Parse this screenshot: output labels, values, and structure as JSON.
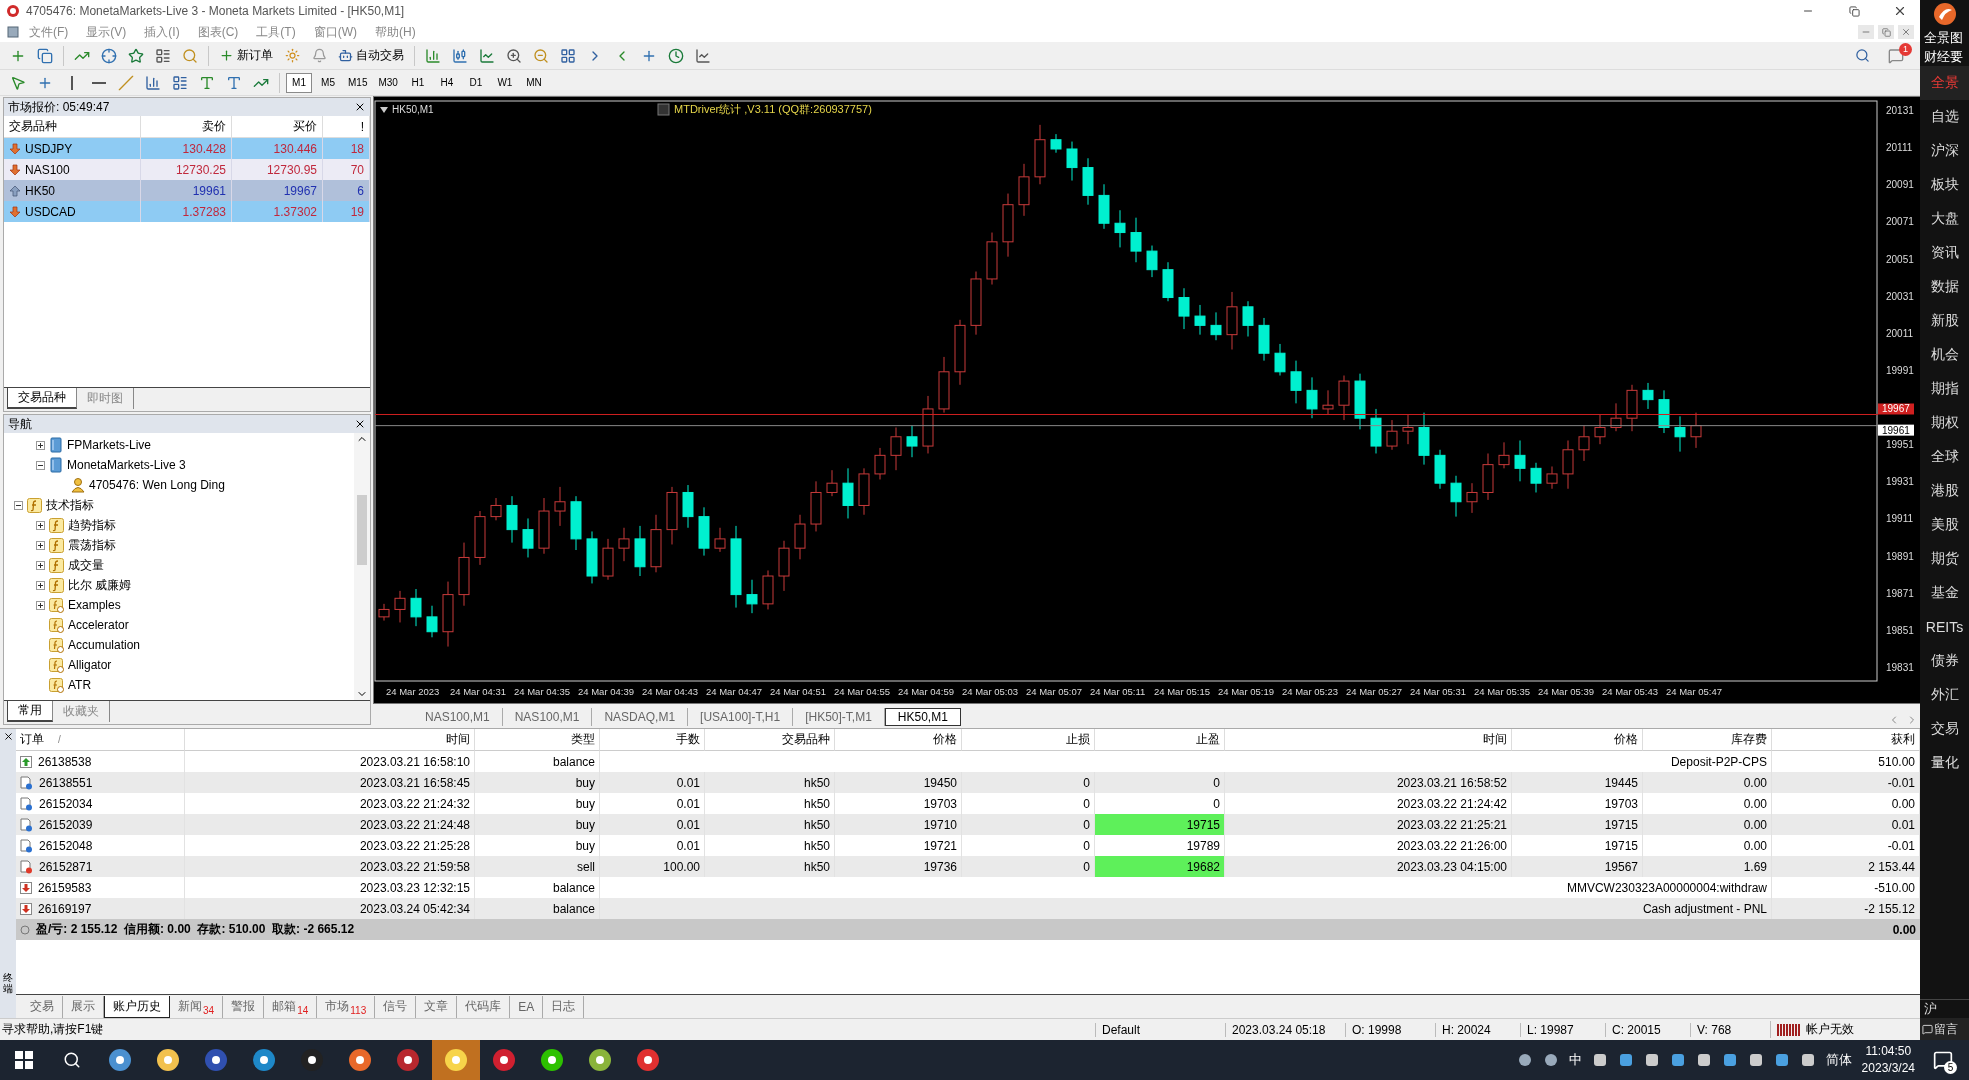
{
  "window": {
    "title": "4705476: MonetaMarkets-Live 3 - Moneta Markets Limited - [HK50,M1]"
  },
  "menu": [
    "文件(F)",
    "显示(V)",
    "插入(I)",
    "图表(C)",
    "工具(T)",
    "窗口(W)",
    "帮助(H)"
  ],
  "toolbar": {
    "new_order": "新订单",
    "auto_trading": "自动交易",
    "alert_count": "1"
  },
  "timeframes": [
    {
      "label": "M1",
      "selected": true
    },
    {
      "label": "M5",
      "selected": false
    },
    {
      "label": "M15",
      "selected": false
    },
    {
      "label": "M30",
      "selected": false
    },
    {
      "label": "H1",
      "selected": false
    },
    {
      "label": "H4",
      "selected": false
    },
    {
      "label": "D1",
      "selected": false
    },
    {
      "label": "W1",
      "selected": false
    },
    {
      "label": "MN",
      "selected": false
    }
  ],
  "market_watch": {
    "title": "市场报价: 05:49:47",
    "columns": [
      "交易品种",
      "卖价",
      "买价",
      "!"
    ],
    "rows": [
      {
        "symbol": "USDJPY",
        "bid": "130.428",
        "ask": "130.446",
        "spread": "18",
        "rising": false,
        "selected": true
      },
      {
        "symbol": "NAS100",
        "bid": "12730.25",
        "ask": "12730.95",
        "spread": "70",
        "rising": false,
        "selected": false
      },
      {
        "symbol": "HK50",
        "bid": "19961",
        "ask": "19967",
        "spread": "6",
        "rising": true,
        "selected": true
      },
      {
        "symbol": "USDCAD",
        "bid": "1.37283",
        "ask": "1.37302",
        "spread": "19",
        "rising": false,
        "selected": true
      }
    ],
    "tabs": [
      {
        "label": "交易品种",
        "selected": true
      },
      {
        "label": "即时图",
        "selected": false
      }
    ]
  },
  "navigator": {
    "title": "导航",
    "tree": [
      {
        "children": [
          {
            "label": "FPMarkets-Live",
            "kind": "server",
            "expanded": false
          },
          {
            "label": "MonetaMarkets-Live 3",
            "kind": "server",
            "expanded": true,
            "children": [
              {
                "label": "4705476: Wen Long Ding",
                "kind": "account"
              }
            ]
          }
        ]
      },
      {
        "label": "技术指标",
        "kind": "folder",
        "expanded": true,
        "children": [
          {
            "label": "趋势指标",
            "kind": "folder",
            "expanded": false
          },
          {
            "label": "震荡指标",
            "kind": "folder",
            "expanded": false
          },
          {
            "label": "成交量",
            "kind": "folder",
            "expanded": false
          },
          {
            "label": "比尔 威廉姆",
            "kind": "folder",
            "expanded": false
          },
          {
            "label": "Examples",
            "kind": "indicator",
            "expanded": false
          },
          {
            "label": "Accelerator",
            "kind": "indicator"
          },
          {
            "label": "Accumulation",
            "kind": "indicator"
          },
          {
            "label": "Alligator",
            "kind": "indicator"
          },
          {
            "label": "ATR",
            "kind": "indicator"
          }
        ]
      }
    ],
    "tabs": [
      {
        "label": "常用",
        "selected": true
      },
      {
        "label": "收藏夹",
        "selected": false
      }
    ]
  },
  "chart": {
    "symbol": "HK50,M1",
    "indicator": "MTDriver统计 ,V3.11 (QQ群:260937757)",
    "price_ticks": [
      "20131",
      "20111",
      "20091",
      "20071",
      "20051",
      "20031",
      "20011",
      "19991",
      "19951",
      "19931",
      "19911",
      "19891",
      "19871",
      "19851",
      "19831"
    ],
    "ask_label": "19967",
    "bid_label": "19961",
    "time_ticks": [
      "24 Mar 2023",
      "24 Mar 04:31",
      "24 Mar 04:35",
      "24 Mar 04:39",
      "24 Mar 04:43",
      "24 Mar 04:47",
      "24 Mar 04:51",
      "24 Mar 04:55",
      "24 Mar 04:59",
      "24 Mar 05:03",
      "24 Mar 05:07",
      "24 Mar 05:11",
      "24 Mar 05:15",
      "24 Mar 05:19",
      "24 Mar 05:23",
      "24 Mar 05:27",
      "24 Mar 05:31",
      "24 Mar 05:35",
      "24 Mar 05:39",
      "24 Mar 05:43",
      "24 Mar 05:47"
    ]
  },
  "chart_tabs": [
    {
      "label": "NAS100,M1",
      "selected": false
    },
    {
      "label": "NAS100,M1",
      "selected": false
    },
    {
      "label": "NASDAQ,M1",
      "selected": false
    },
    {
      "label": "[USA100]-T,H1",
      "selected": false
    },
    {
      "label": "[HK50]-T,M1",
      "selected": false
    },
    {
      "label": "HK50,M1",
      "selected": true
    }
  ],
  "terminal": {
    "side_label": "终端",
    "sort_mark": "/",
    "columns": [
      "订单",
      "时间",
      "类型",
      "手数",
      "交易品种",
      "价格",
      "止损",
      "止盈",
      "时间",
      "价格",
      "库存费",
      "获利"
    ],
    "rows": [
      {
        "kind": "deposit",
        "order": "26138538",
        "open_time": "2023.03.21 16:58:10",
        "type": "balance",
        "comment": "Deposit-P2P-CPS",
        "profit": "510.00"
      },
      {
        "kind": "buy",
        "order": "26138551",
        "open_time": "2023.03.21 16:58:45",
        "type": "buy",
        "size": "0.01",
        "symbol": "hk50",
        "open_price": "19450",
        "sl": "0",
        "tp": {
          "text": "0",
          "hit": false
        },
        "close_time": "2023.03.21 16:58:52",
        "close_price": "19445",
        "swap": "0.00",
        "profit": "-0.01"
      },
      {
        "kind": "buy",
        "order": "26152034",
        "open_time": "2023.03.22 21:24:32",
        "type": "buy",
        "size": "0.01",
        "symbol": "hk50",
        "open_price": "19703",
        "sl": "0",
        "tp": {
          "text": "0",
          "hit": false
        },
        "close_time": "2023.03.22 21:24:42",
        "close_price": "19703",
        "swap": "0.00",
        "profit": "0.00"
      },
      {
        "kind": "buy",
        "order": "26152039",
        "open_time": "2023.03.22 21:24:48",
        "type": "buy",
        "size": "0.01",
        "symbol": "hk50",
        "open_price": "19710",
        "sl": "0",
        "tp": {
          "text": "19715",
          "hit": true
        },
        "close_time": "2023.03.22 21:25:21",
        "close_price": "19715",
        "swap": "0.00",
        "profit": "0.01"
      },
      {
        "kind": "buy",
        "order": "26152048",
        "open_time": "2023.03.22 21:25:28",
        "type": "buy",
        "size": "0.01",
        "symbol": "hk50",
        "open_price": "19721",
        "sl": "0",
        "tp": {
          "text": "19789",
          "hit": false
        },
        "close_time": "2023.03.22 21:26:00",
        "close_price": "19715",
        "swap": "0.00",
        "profit": "-0.01"
      },
      {
        "kind": "sell",
        "order": "26152871",
        "open_time": "2023.03.22 21:59:58",
        "type": "sell",
        "size": "100.00",
        "symbol": "hk50",
        "open_price": "19736",
        "sl": "0",
        "tp": {
          "text": "19682",
          "hit": true
        },
        "close_time": "2023.03.23 04:15:00",
        "close_price": "19567",
        "swap": "1.69",
        "profit": "2 153.44"
      },
      {
        "kind": "withdrawal",
        "order": "26159583",
        "open_time": "2023.03.23 12:32:15",
        "type": "balance",
        "comment": "MMVCW230323A00000004:withdraw",
        "profit": "-510.00"
      },
      {
        "kind": "withdrawal",
        "order": "26169197",
        "open_time": "2023.03.24 05:42:34",
        "type": "balance",
        "comment": "Cash adjustment - PNL",
        "profit": "-2 155.12"
      }
    ],
    "summary": "盈/亏: 2 155.12  信用额: 0.00  存款: 510.00  取款: -2 665.12",
    "summary_total": "0.00",
    "tabs": [
      {
        "label": "交易",
        "selected": false
      },
      {
        "label": "展示",
        "selected": false
      },
      {
        "label": "账户历史",
        "selected": true
      },
      {
        "label": "新闻",
        "count": "34",
        "selected": false
      },
      {
        "label": "警报",
        "selected": false
      },
      {
        "label": "邮箱",
        "count": "14",
        "selected": false
      },
      {
        "label": "市场",
        "count": "113",
        "selected": false
      },
      {
        "label": "信号",
        "selected": false
      },
      {
        "label": "文章",
        "selected": false
      },
      {
        "label": "代码库",
        "selected": false
      },
      {
        "label": "EA",
        "selected": false
      },
      {
        "label": "日志",
        "selected": false
      }
    ]
  },
  "status_bar": {
    "help": "寻求帮助,请按F1键",
    "profile": "Default",
    "datetime": "2023.03.24 05:18",
    "open": "O: 19998",
    "high": "H: 20024",
    "low": "L: 19987",
    "close": "C: 20015",
    "volume": "V: 768",
    "connection": "帐户无效"
  },
  "sidebar": {
    "header": [
      "全景图",
      "财经要"
    ],
    "items": [
      {
        "label": "全景",
        "selected": true
      },
      {
        "label": "自选",
        "selected": false
      },
      {
        "label": "沪深",
        "selected": false
      },
      {
        "label": "板块",
        "selected": false
      },
      {
        "label": "大盘",
        "selected": false
      },
      {
        "label": "资讯",
        "selected": false
      },
      {
        "label": "数据",
        "selected": false
      },
      {
        "label": "新股",
        "selected": false
      },
      {
        "label": "机会",
        "selected": false
      },
      {
        "label": "期指",
        "selected": false
      },
      {
        "label": "期权",
        "selected": false
      },
      {
        "label": "全球",
        "selected": false
      },
      {
        "label": "港股",
        "selected": false
      },
      {
        "label": "美股",
        "selected": false
      },
      {
        "label": "期货",
        "selected": false
      },
      {
        "label": "基金",
        "selected": false
      },
      {
        "label": "REITs",
        "selected": false
      },
      {
        "label": "债券",
        "selected": false
      },
      {
        "label": "外汇",
        "selected": false
      },
      {
        "label": "交易",
        "selected": false
      },
      {
        "label": "量化",
        "selected": false
      }
    ],
    "footer": "沪",
    "message": "留言"
  },
  "taskbar": {
    "apps": [
      {
        "color": "#4a90d0",
        "selected": false
      },
      {
        "color": "#f2c14e",
        "selected": false
      },
      {
        "color": "#3050b0",
        "selected": false
      },
      {
        "color": "#1e88c8",
        "selected": false
      },
      {
        "color": "#222222",
        "selected": false
      },
      {
        "color": "#e8682a",
        "selected": false
      },
      {
        "color": "#b8282e",
        "selected": false
      },
      {
        "color": "#f7d44a",
        "selected": true
      },
      {
        "color": "#d02030",
        "selected": false
      },
      {
        "color": "#2dc100",
        "selected": false
      },
      {
        "color": "#8ab43a",
        "selected": false
      },
      {
        "color": "#e03030",
        "selected": false
      }
    ],
    "ime": "中",
    "language": "简体",
    "time": "11:04:50",
    "date": "2023/3/24",
    "notifications": "5"
  }
}
